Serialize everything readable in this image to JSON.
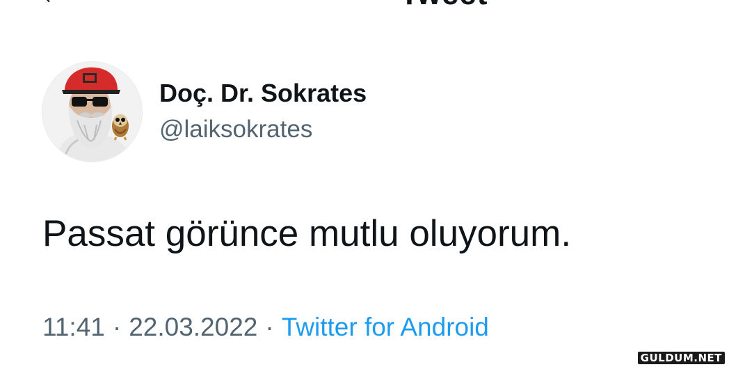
{
  "header": {
    "title": "Tweet",
    "back_icon": "arrow-left-icon"
  },
  "author": {
    "display_name": "Doç. Dr. Sokrates",
    "handle": "@laiksokrates",
    "avatar_icon": "bearded-man-with-cap-and-owl-avatar"
  },
  "tweet": {
    "text": "Passat görünce mutlu oluyorum.",
    "time": "11:41",
    "separator": "·",
    "date": "22.03.2022",
    "source": "Twitter for Android"
  },
  "watermark": {
    "text": "GULDUM.NET"
  },
  "colors": {
    "primary_text": "#0f1419",
    "secondary_text": "#536471",
    "link": "#1d9bf0",
    "background": "#ffffff"
  }
}
